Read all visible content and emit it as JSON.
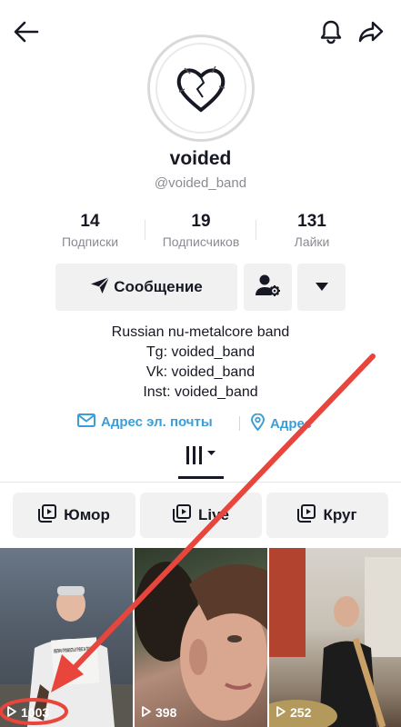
{
  "header": {
    "back_icon": "arrow-left-icon",
    "notification_icon": "bell-icon",
    "share_icon": "share-arrow-icon"
  },
  "profile": {
    "display_name": "voided",
    "handle": "@voided_band",
    "avatar_icon": "broken-heart-logo"
  },
  "stats": [
    {
      "value": "14",
      "label": "Подписки"
    },
    {
      "value": "19",
      "label": "Подписчиков"
    },
    {
      "value": "131",
      "label": "Лайки"
    }
  ],
  "actions": {
    "message_label": "Сообщение",
    "message_icon": "send-icon",
    "add_friend_icon": "user-gear-icon",
    "more_icon": "triangle-down-icon"
  },
  "bio": [
    "Russian nu-metalcore band",
    "Tg: voided_band",
    "Vk: voided_band",
    "Inst: voided_band"
  ],
  "links": {
    "email_label": "Адрес эл. почты",
    "address_label": "Адрес"
  },
  "tabs": {
    "active_icon": "grid-bars-icon"
  },
  "playlists": [
    {
      "label": "Юмор"
    },
    {
      "label": "Live"
    },
    {
      "label": "Круг"
    }
  ],
  "videos": [
    {
      "views": "1003",
      "caption_text": "УВЕЛИЧУ ГРОМКОСТЬ В ТРЕКЕ ЗА ПОЦЕЛУЙ"
    },
    {
      "views": "398"
    },
    {
      "views": "252"
    }
  ],
  "colors": {
    "link": "#3b9ed6",
    "button_bg": "#f1f1f2",
    "annotation_red": "#e8453c"
  }
}
